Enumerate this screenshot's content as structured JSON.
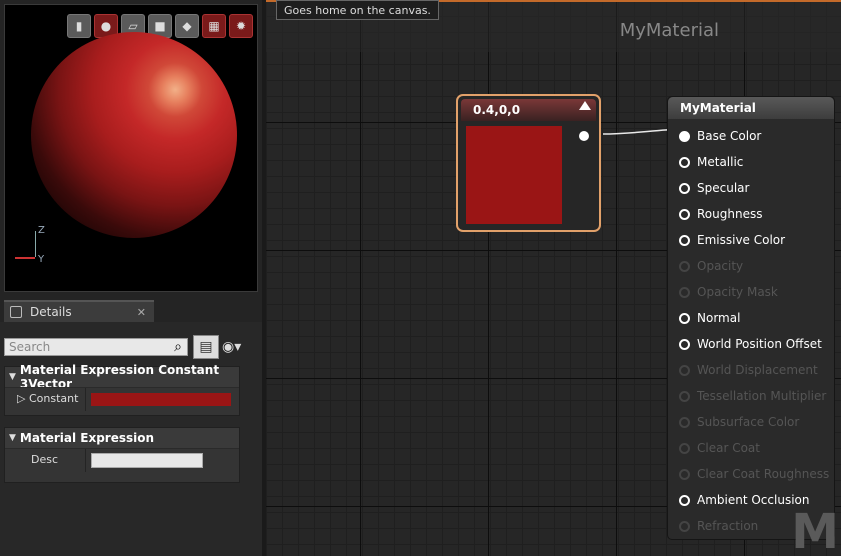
{
  "viewport": {
    "toolbar_icons": [
      {
        "icon": "cylinder-icon",
        "glyph": "▮"
      },
      {
        "icon": "sphere-icon",
        "glyph": "●"
      },
      {
        "icon": "plane-icon",
        "glyph": "▱"
      },
      {
        "icon": "cube-icon",
        "glyph": "■"
      },
      {
        "icon": "mesh-icon",
        "glyph": "◆"
      },
      {
        "icon": "grid-icon",
        "glyph": "▦"
      },
      {
        "icon": "realtime-icon",
        "glyph": "✹"
      }
    ],
    "axis": {
      "z": "Z",
      "y": "Y"
    }
  },
  "details": {
    "tab_label": "Details",
    "close_glyph": "✕",
    "search_placeholder": "Search",
    "search_glyph": "⌕",
    "view_glyph": "▤",
    "eye_glyph": "◉▾",
    "sections": {
      "constant": {
        "title": "Material Expression Constant 3Vector",
        "prop_label": "Constant",
        "color": "#9a1515"
      },
      "expression": {
        "title": "Material Expression",
        "prop_label": "Desc"
      }
    }
  },
  "graph": {
    "title": "MyMaterial",
    "tooltip": "Goes home on the canvas.",
    "watermark": "M",
    "constant_node": {
      "title": "0.4,0,0",
      "color": "#9a1515"
    },
    "material_node": {
      "title": "MyMaterial",
      "pins": [
        {
          "label": "Base Color",
          "enabled": true,
          "connected": true
        },
        {
          "label": "Metallic",
          "enabled": true,
          "connected": false
        },
        {
          "label": "Specular",
          "enabled": true,
          "connected": false
        },
        {
          "label": "Roughness",
          "enabled": true,
          "connected": false
        },
        {
          "label": "Emissive Color",
          "enabled": true,
          "connected": false
        },
        {
          "label": "Opacity",
          "enabled": false,
          "connected": false
        },
        {
          "label": "Opacity Mask",
          "enabled": false,
          "connected": false
        },
        {
          "label": "Normal",
          "enabled": true,
          "connected": false
        },
        {
          "label": "World Position Offset",
          "enabled": true,
          "connected": false
        },
        {
          "label": "World Displacement",
          "enabled": false,
          "connected": false
        },
        {
          "label": "Tessellation Multiplier",
          "enabled": false,
          "connected": false
        },
        {
          "label": "Subsurface Color",
          "enabled": false,
          "connected": false
        },
        {
          "label": "Clear Coat",
          "enabled": false,
          "connected": false
        },
        {
          "label": "Clear Coat Roughness",
          "enabled": false,
          "connected": false
        },
        {
          "label": "Ambient Occlusion",
          "enabled": true,
          "connected": false
        },
        {
          "label": "Refraction",
          "enabled": false,
          "connected": false
        }
      ]
    }
  }
}
